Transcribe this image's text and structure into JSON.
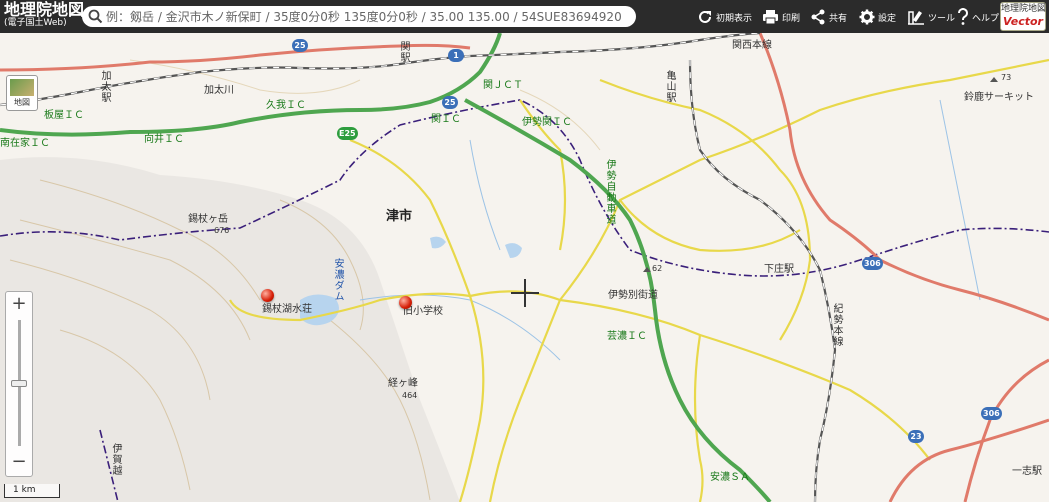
{
  "header": {
    "logo_main": "地理院地図",
    "logo_sub": "(電子国土Web)",
    "search_placeholder": "例：剱岳 / 金沢市木ノ新保町 / 35度0分0秒 135度0分0秒 / 35.00 135.00 / 54SUE83694920",
    "buttons": {
      "initial_view": "初期表示",
      "print": "印刷",
      "share": "共有",
      "settings": "設定",
      "tools": "ツール",
      "help": "ヘルプ"
    },
    "vector_badge_top": "地理院地図",
    "vector_badge_bottom": "Vector"
  },
  "controls": {
    "layer_button": "地図",
    "zoom_in": "+",
    "zoom_out": "−",
    "zoom_level_fraction": 0.5,
    "scale_label": "1 km"
  },
  "map": {
    "city_label": "津市",
    "place_labels": {
      "kabuto": "加太駅",
      "seki_station": "関駅",
      "kameyama_station": "亀山駅",
      "kansai_line": "関西本線",
      "kansai_line2": "関西本線",
      "kabuto_river": "加太川",
      "suzuka_circuit": "鈴鹿サーキット",
      "suzuka_circuit_elev": "73",
      "itaya_ic": "板屋ＩＣ",
      "kubo_ic": "久我ＩＣ",
      "mukai_ic": "向井ＩＣ",
      "seki_ic": "関ＩＣ",
      "seki_jct": "関ＪＣＴ",
      "ise_seki_ic": "伊勢関ＩＣ",
      "minami_zaike_ic": "南在家ＩＣ",
      "nishikijo": "錫杖ヶ岳",
      "nishikijo_elev": "676",
      "anou_dam": "安濃ダム",
      "nishikijo_lake_lodge": "錫杖湖水荘",
      "old_school": "旧小学校",
      "tsuzumigatake": "経ヶ峰",
      "tsuzumigatake_elev": "464",
      "ise_road": "伊勢自動車道",
      "ise_betsukaido": "伊勢別街道",
      "geino_ic": "芸濃ＩＣ",
      "shimonosho_station": "下庄駅",
      "kisei_line": "紀勢本線",
      "anou_sa": "安濃ＳＡ",
      "ibaraki_pass": "伊賀越",
      "ichishi_station": "一志駅",
      "elev_62": "62"
    },
    "shields": {
      "r25a": "25",
      "r25b": "25",
      "r1": "1",
      "e25": "E25",
      "r306a": "306",
      "r306b": "306",
      "r23": "23"
    },
    "colors": {
      "expressway": "#4fa650",
      "national_road": "#e07a6a",
      "prefectural_road": "#e8d84a",
      "railway": "#555555",
      "boundary": "#3a1f7a",
      "water": "#b7d4ee"
    }
  }
}
